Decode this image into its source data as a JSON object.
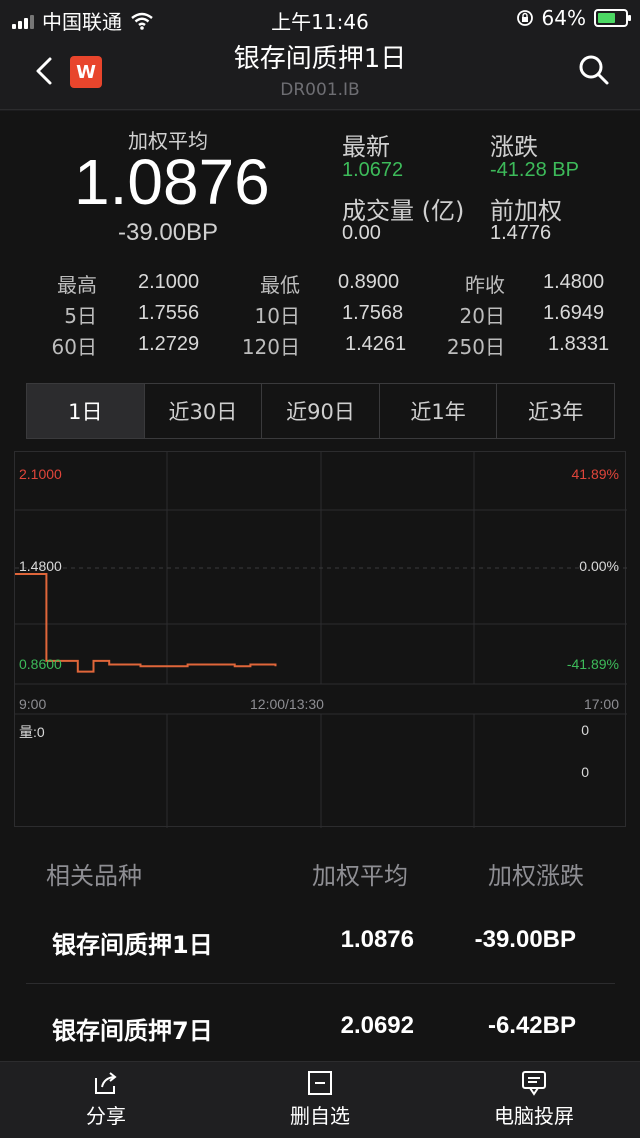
{
  "status_bar": {
    "carrier": "中国联通",
    "time": "上午11:46",
    "battery": "64%",
    "battery_level": 0.64
  },
  "nav": {
    "title": "银存间质押1日",
    "subtitle": "DR001.IB",
    "logo_letter": "W"
  },
  "quote": {
    "avg_label": "加权平均",
    "avg_value": "1.0876",
    "avg_change": "-39.00BP",
    "latest_label": "最新",
    "latest_value": "1.0672",
    "change_label": "涨跌",
    "change_value": "-41.28 BP",
    "volume_label": "成交量 (亿)",
    "volume_value": "0.00",
    "prev_label": "前加权",
    "prev_value": "1.4776"
  },
  "stats": [
    [
      {
        "label": "最高",
        "value": "2.1000"
      },
      {
        "label": "最低",
        "value": "0.8900"
      },
      {
        "label": "昨收",
        "value": "1.4800"
      }
    ],
    [
      {
        "label": "5日",
        "value": "1.7556"
      },
      {
        "label": "10日",
        "value": "1.7568"
      },
      {
        "label": "20日",
        "value": "1.6949"
      }
    ],
    [
      {
        "label": "60日",
        "value": "1.2729"
      },
      {
        "label": "120日",
        "value": "1.4261"
      },
      {
        "label": "250日",
        "value": "1.8331"
      }
    ]
  ],
  "tabs": [
    "1日",
    "近30日",
    "近90日",
    "近1年",
    "近3年"
  ],
  "chart": {
    "y_top": "2.1000",
    "y_mid": "1.4800",
    "y_bot": "0.8600",
    "pct_top": "41.89%",
    "pct_mid": "0.00%",
    "pct_bot": "-41.89%",
    "x_start": "9:00",
    "x_mid": "12:00/13:30",
    "x_end": "17:00",
    "vol_label": "量:0",
    "vol_top": "0",
    "vol_bot": "0",
    "colors": {
      "line": "#e0663a",
      "up": "#e0453a",
      "down": "#3dbb5a"
    }
  },
  "chart_data": {
    "type": "line",
    "x": [
      "9:00",
      "9:10",
      "9:20",
      "9:30",
      "9:40",
      "9:50",
      "10:00",
      "10:10",
      "10:20",
      "10:30",
      "10:40",
      "10:50",
      "11:00",
      "11:10",
      "11:20",
      "11:30",
      "11:40",
      "11:46"
    ],
    "series": [
      {
        "values": [
          1.48,
          1.48,
          0.99,
          0.99,
          0.93,
          0.99,
          0.97,
          0.97,
          0.96,
          0.96,
          0.96,
          0.97,
          0.97,
          0.97,
          0.96,
          0.97,
          0.97,
          0.96
        ]
      }
    ],
    "ylim": [
      0.86,
      2.1
    ],
    "y_ticks": [
      "2.1000",
      "1.4800",
      "0.8600"
    ],
    "x_ticks": [
      "9:00",
      "12:00/13:30",
      "17:00"
    ],
    "grid": true
  },
  "related": {
    "headers": [
      "相关品种",
      "加权平均",
      "加权涨跌"
    ],
    "rows": [
      {
        "name": "银存间质押1日",
        "avg": "1.0876",
        "chg": "-39.00BP"
      },
      {
        "name": "银存间质押7日",
        "avg": "2.0692",
        "chg": "-6.42BP"
      }
    ]
  },
  "bottom_bar": {
    "share": "分享",
    "remove": "删自选",
    "cast": "电脑投屏"
  }
}
